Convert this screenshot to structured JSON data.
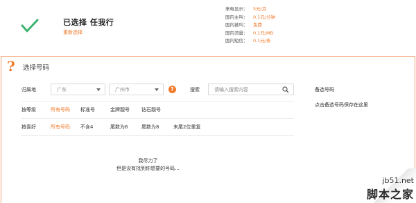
{
  "selection": {
    "title": "已选择  任我行",
    "reselect_label": "重新选择",
    "fees": [
      {
        "label": "来电显示：",
        "value": "5元/月"
      },
      {
        "label": "国内主叫：",
        "value": "0.1元/分钟"
      },
      {
        "label": "国内被叫：",
        "value": "免费"
      },
      {
        "label": "国内流量：",
        "value": "0.1元/MB"
      },
      {
        "label": "国内短信：",
        "value": "0.1元/条"
      }
    ]
  },
  "panel": {
    "title": "选择号码",
    "location_label": "归属地",
    "province": "广东",
    "city": "广州市",
    "help": "?",
    "search_label": "搜索",
    "search_placeholder": "请输入搜索内容",
    "grade_label": "按等级",
    "grade_options": [
      "所有号码",
      "标准号",
      "金牌靓号",
      "钻石靓号"
    ],
    "pref_label": "按喜好",
    "pref_options": [
      "所有号码",
      "不含4",
      "尾数为6",
      "尾数为8",
      "末尾2位重复"
    ],
    "empty_title": "我尽力了",
    "empty_desc": "但是没有找到你想要的号码..."
  },
  "sidebar": {
    "title": "备选号码",
    "note": "点击备选号码保存在这里"
  },
  "watermark": {
    "url": "jb51.net",
    "name": "脚本之家"
  },
  "colors": {
    "accent": "#f07a2a",
    "check": "#3cb371",
    "panel_border": "#f3a070"
  }
}
